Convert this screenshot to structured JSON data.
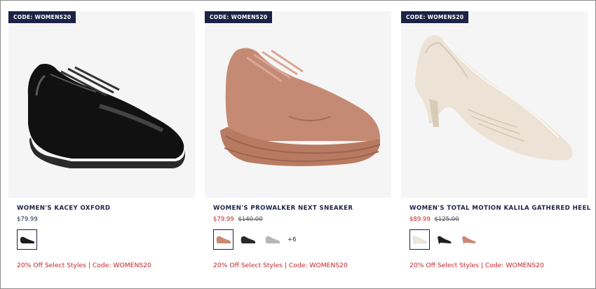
{
  "products": [
    {
      "badge": "CODE: WOMENS20",
      "name": "WOMEN'S KACEY OXFORD",
      "price": "$79.99",
      "was_price": "",
      "more_colors": "",
      "promo": "20% Off Select Styles | Code: WOMENS20",
      "swatch_colors": [
        "#1b1b1b"
      ]
    },
    {
      "badge": "CODE: WOMENS20",
      "name": "WOMEN'S PROWALKER NEXT SNEAKER",
      "price": "$79.99",
      "was_price": "$140.00",
      "more_colors": "+6",
      "promo": "20% Off Select Styles | Code: WOMENS20",
      "swatch_colors": [
        "#c98a73",
        "#2a2a2a",
        "#b9b6b1"
      ]
    },
    {
      "badge": "CODE: WOMENS20",
      "name": "WOMEN'S TOTAL MOTION KALILA GATHERED HEEL",
      "price": "$89.99",
      "was_price": "$125.00",
      "more_colors": "",
      "promo": "20% Off Select Styles | Code: WOMENS20",
      "swatch_colors": [
        "#efe6da",
        "#1e1e1e",
        "#c98a73"
      ]
    }
  ]
}
